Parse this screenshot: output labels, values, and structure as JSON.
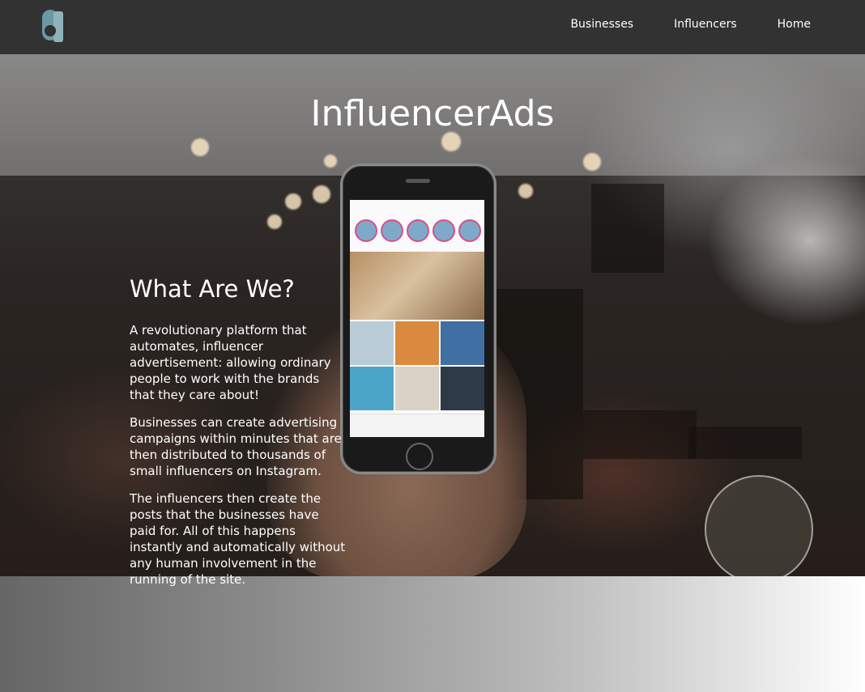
{
  "header": {
    "logo_letter": "a",
    "nav": [
      {
        "label": "Businesses"
      },
      {
        "label": "Influencers"
      },
      {
        "label": "Home"
      }
    ]
  },
  "hero": {
    "title": "InfluencerAds"
  },
  "about": {
    "heading": "What Are We?",
    "paragraphs": [
      "A revolutionary platform that automates, influencer advertisement: allowing ordinary people to work with the brands that they care about!",
      "Businesses can create advertising campaigns within minutes that are then distributed to thousands of small influencers on Instagram.",
      "The influencers then create the posts that the businesses have paid for. All of this happens instantly and automatically without any human involvement in the running of the site."
    ]
  },
  "colors": {
    "header_bg": "#323232",
    "logo_teal": "#5f8f9a"
  }
}
